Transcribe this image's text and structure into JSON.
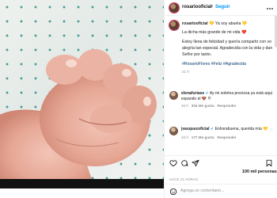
{
  "post": {
    "username": "rosariooficial",
    "follow_label": "Seguir",
    "separator": "•",
    "caption": {
      "line1": "💛 Ya soy abuela 💛",
      "line2": "La dicha más grande de mi vida ❤️",
      "line3": "Estoy llena de felicidad y quería compartir con vo",
      "line4": "alegría tan especial. Agradecida con la vida y dan",
      "line5": "Señor por tanto.",
      "hashtags": "#RosarioFlores #Feliz #Agradecida",
      "time": "21 h"
    },
    "comments": [
      {
        "username": "elenafuriase",
        "verified": "✔",
        "text": "Ay mi sobrina preciosa ya está aquí",
        "text2": "expando el 🤎 !!!",
        "time": "16 h",
        "likes": "304 Me gusta",
        "reply": "Responder"
      },
      {
        "username": "jvasquezoficial",
        "verified": "✔",
        "text": "Enhorabuena, querida mía 💛",
        "time": "16 h",
        "likes": "177 Me gusta",
        "reply": "Responder"
      }
    ],
    "likes_count": "100 mil personas",
    "date": "HACE 21 HORAS",
    "add_comment_placeholder": "Agrega un comentario..."
  },
  "icons": {
    "like": "heart-icon",
    "comment": "comment-icon",
    "share": "share-icon",
    "save": "bookmark-icon",
    "emoji": "smile-icon",
    "more": "more-icon"
  },
  "colors": {
    "follow": "#0095f6",
    "hashtag": "#00376b",
    "heart": "#ed4956",
    "dots": "#2e8f86"
  }
}
